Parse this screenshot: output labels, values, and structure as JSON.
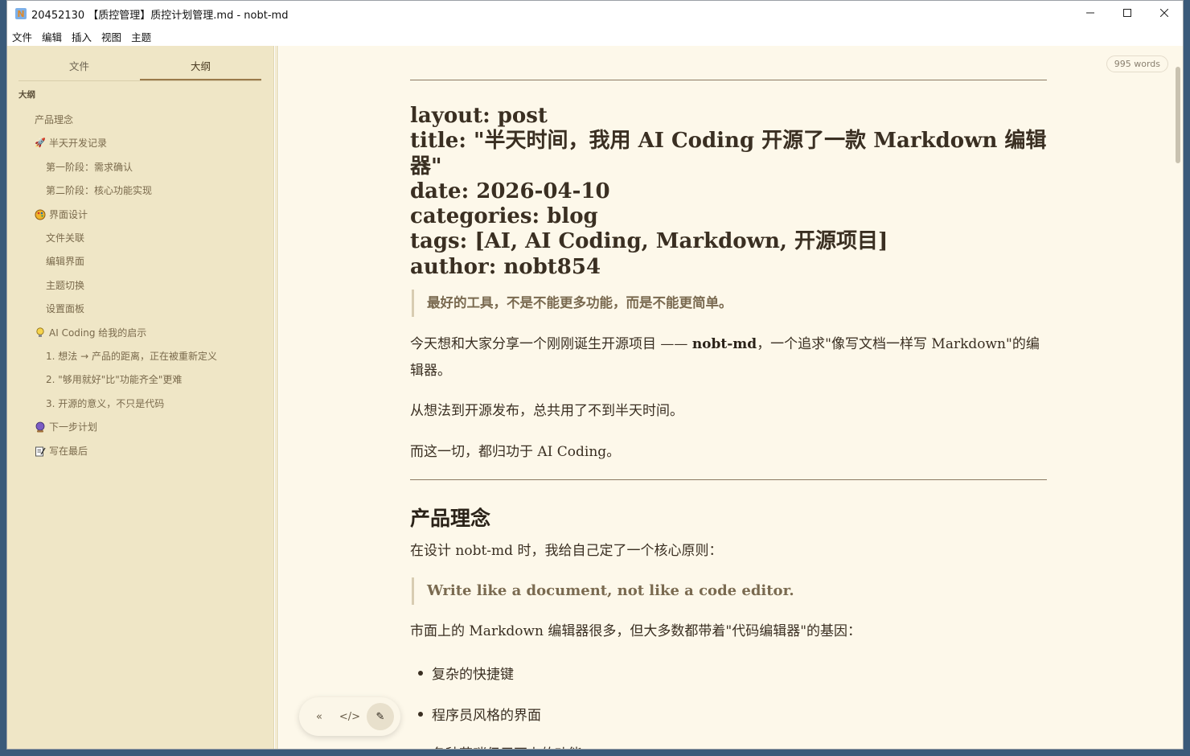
{
  "window": {
    "title": "20452130 【质控管理】质控计划管理.md - nobt-md",
    "icon_letter": "N"
  },
  "menu": [
    "文件",
    "编辑",
    "插入",
    "视图",
    "主题"
  ],
  "sidebar": {
    "tabs": [
      "文件",
      "大纲"
    ],
    "active_tab": "大纲",
    "outline_heading": "大纲",
    "items": [
      {
        "label": "产品理念",
        "icon": ""
      },
      {
        "label": "半天开发记录",
        "icon": "rocket-icon"
      },
      {
        "label": "第一阶段：需求确认",
        "icon": ""
      },
      {
        "label": "第二阶段：核心功能实现",
        "icon": ""
      },
      {
        "label": "界面设计",
        "icon": "palette-icon"
      },
      {
        "label": "文件关联",
        "icon": ""
      },
      {
        "label": "编辑界面",
        "icon": ""
      },
      {
        "label": "主题切换",
        "icon": ""
      },
      {
        "label": "设置面板",
        "icon": ""
      },
      {
        "label": "AI Coding 给我的启示",
        "icon": "lightbulb-icon"
      },
      {
        "label": "1. 想法 → 产品的距离，正在被重新定义",
        "icon": ""
      },
      {
        "label": "2. \"够用就好\"比\"功能齐全\"更难",
        "icon": ""
      },
      {
        "label": "3. 开源的意义，不只是代码",
        "icon": ""
      },
      {
        "label": "下一步计划",
        "icon": "crystal-ball-icon"
      },
      {
        "label": "写在最后",
        "icon": "memo-icon"
      }
    ]
  },
  "editor": {
    "word_count": "995 words",
    "frontmatter": [
      "layout: post",
      "title: \"半天时间，我用 AI Coding 开源了一款 Markdown 编辑器\"",
      "date: 2026-04-10",
      "categories: blog",
      "tags: [AI, AI Coding, Markdown, 开源项目]",
      "author: nobt854"
    ],
    "quote1": "最好的工具，不是不能更多功能，而是不能更简单。",
    "para1_a": "今天想和大家分享一个刚刚诞生开源项目 —— ",
    "para1_bold": "nobt-md",
    "para1_b": "，一个追求\"像写文档一样写 Markdown\"的编辑器。",
    "para2": "从想法到开源发布，总共用了不到半天时间。",
    "para3": "而这一切，都归功于 AI Coding。",
    "h2": "产品理念",
    "para4": "在设计 nobt-md 时，我给自己定了一个核心原则：",
    "quote2": "Write like a document, not like a code editor.",
    "para5": "市面上的 Markdown 编辑器很多，但大多数都带着\"代码编辑器\"的基因：",
    "bullets": [
      "复杂的快捷键",
      "程序员风格的界面",
      "各种花哨但用不上的功能"
    ]
  },
  "toolbar": {
    "collapse_label": "«",
    "source_label": "</>",
    "edit_label": "✎"
  }
}
